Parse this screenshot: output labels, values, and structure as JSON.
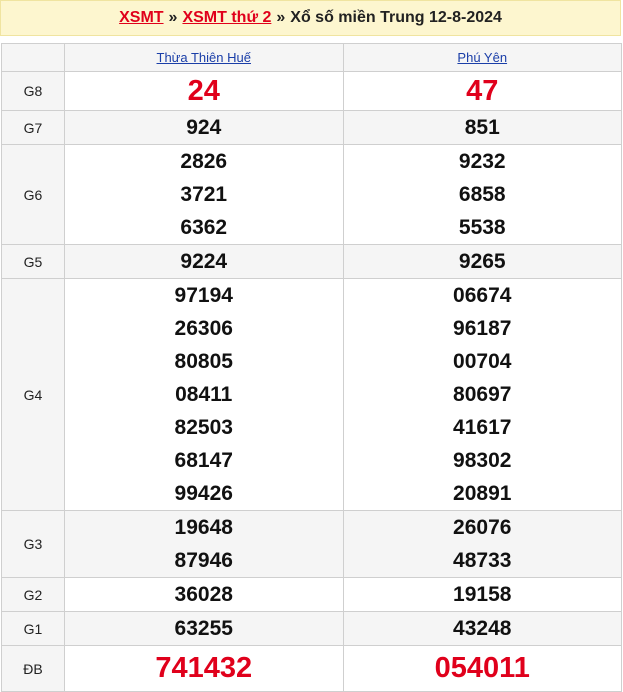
{
  "breadcrumb": {
    "link1": "XSMT",
    "sep1": "»",
    "link2": "XSMT thứ 2",
    "sep2": "»",
    "title": "Xổ số miền Trung 12-8-2024"
  },
  "provinces": [
    "Thừa Thiên Huế",
    "Phú Yên"
  ],
  "prizes": {
    "G8": {
      "label": "G8",
      "col1": [
        "24"
      ],
      "col2": [
        "47"
      ]
    },
    "G7": {
      "label": "G7",
      "col1": [
        "924"
      ],
      "col2": [
        "851"
      ]
    },
    "G6": {
      "label": "G6",
      "col1": [
        "2826",
        "3721",
        "6362"
      ],
      "col2": [
        "9232",
        "6858",
        "5538"
      ]
    },
    "G5": {
      "label": "G5",
      "col1": [
        "9224"
      ],
      "col2": [
        "9265"
      ]
    },
    "G4": {
      "label": "G4",
      "col1": [
        "97194",
        "26306",
        "80805",
        "08411",
        "82503",
        "68147",
        "99426"
      ],
      "col2": [
        "06674",
        "96187",
        "00704",
        "80697",
        "41617",
        "98302",
        "20891"
      ]
    },
    "G3": {
      "label": "G3",
      "col1": [
        "19648",
        "87946"
      ],
      "col2": [
        "26076",
        "48733"
      ]
    },
    "G2": {
      "label": "G2",
      "col1": [
        "36028"
      ],
      "col2": [
        "19158"
      ]
    },
    "G1": {
      "label": "G1",
      "col1": [
        "63255"
      ],
      "col2": [
        "43248"
      ]
    },
    "DB": {
      "label": "ĐB",
      "col1": [
        "741432"
      ],
      "col2": [
        "054011"
      ]
    }
  },
  "colors": {
    "accent_red": "#e0001b",
    "link_blue": "#1a3ea8",
    "header_bg": "#fdf6cf"
  }
}
